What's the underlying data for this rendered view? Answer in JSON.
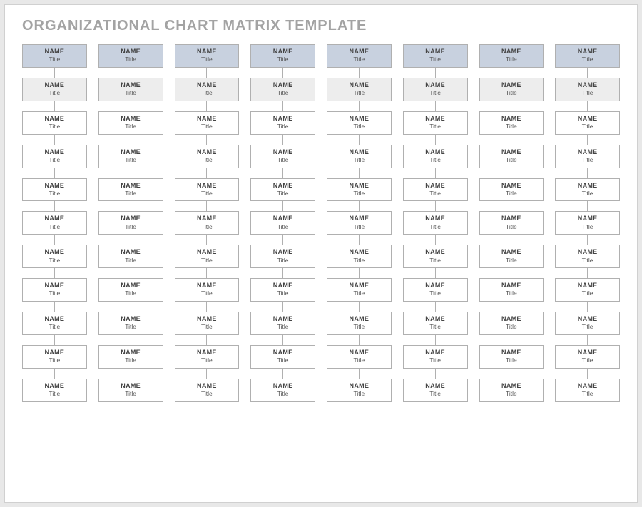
{
  "heading": "ORGANIZATIONAL CHART MATRIX TEMPLATE",
  "columns": [
    {
      "boxes": [
        {
          "name": "NAME",
          "title": "Title"
        },
        {
          "name": "NAME",
          "title": "Title"
        },
        {
          "name": "NAME",
          "title": "Title"
        },
        {
          "name": "NAME",
          "title": "Title"
        },
        {
          "name": "NAME",
          "title": "Title"
        },
        {
          "name": "NAME",
          "title": "Title"
        },
        {
          "name": "NAME",
          "title": "Title"
        },
        {
          "name": "NAME",
          "title": "Title"
        },
        {
          "name": "NAME",
          "title": "Title"
        },
        {
          "name": "NAME",
          "title": "Title"
        },
        {
          "name": "NAME",
          "title": "Title"
        }
      ]
    },
    {
      "boxes": [
        {
          "name": "NAME",
          "title": "Title"
        },
        {
          "name": "NAME",
          "title": "Title"
        },
        {
          "name": "NAME",
          "title": "Title"
        },
        {
          "name": "NAME",
          "title": "Title"
        },
        {
          "name": "NAME",
          "title": "Title"
        },
        {
          "name": "NAME",
          "title": "Title"
        },
        {
          "name": "NAME",
          "title": "Title"
        },
        {
          "name": "NAME",
          "title": "Title"
        },
        {
          "name": "NAME",
          "title": "Title"
        },
        {
          "name": "NAME",
          "title": "Title"
        },
        {
          "name": "NAME",
          "title": "Title"
        }
      ]
    },
    {
      "boxes": [
        {
          "name": "NAME",
          "title": "Title"
        },
        {
          "name": "NAME",
          "title": "Title"
        },
        {
          "name": "NAME",
          "title": "Title"
        },
        {
          "name": "NAME",
          "title": "Title"
        },
        {
          "name": "NAME",
          "title": "Title"
        },
        {
          "name": "NAME",
          "title": "Title"
        },
        {
          "name": "NAME",
          "title": "Title"
        },
        {
          "name": "NAME",
          "title": "Title"
        },
        {
          "name": "NAME",
          "title": "Title"
        },
        {
          "name": "NAME",
          "title": "Title"
        },
        {
          "name": "NAME",
          "title": "Title"
        }
      ]
    },
    {
      "boxes": [
        {
          "name": "NAME",
          "title": "Title"
        },
        {
          "name": "NAME",
          "title": "Title"
        },
        {
          "name": "NAME",
          "title": "Title"
        },
        {
          "name": "NAME",
          "title": "Title"
        },
        {
          "name": "NAME",
          "title": "Title"
        },
        {
          "name": "NAME",
          "title": "Title"
        },
        {
          "name": "NAME",
          "title": "Title"
        },
        {
          "name": "NAME",
          "title": "Title"
        },
        {
          "name": "NAME",
          "title": "Title"
        },
        {
          "name": "NAME",
          "title": "Title"
        },
        {
          "name": "NAME",
          "title": "Title"
        }
      ]
    },
    {
      "boxes": [
        {
          "name": "NAME",
          "title": "Title"
        },
        {
          "name": "NAME",
          "title": "Title"
        },
        {
          "name": "NAME",
          "title": "Title"
        },
        {
          "name": "NAME",
          "title": "Title"
        },
        {
          "name": "NAME",
          "title": "Title"
        },
        {
          "name": "NAME",
          "title": "Title"
        },
        {
          "name": "NAME",
          "title": "Title"
        },
        {
          "name": "NAME",
          "title": "Title"
        },
        {
          "name": "NAME",
          "title": "Title"
        },
        {
          "name": "NAME",
          "title": "Title"
        },
        {
          "name": "NAME",
          "title": "Title"
        }
      ]
    },
    {
      "boxes": [
        {
          "name": "NAME",
          "title": "Title"
        },
        {
          "name": "NAME",
          "title": "Title"
        },
        {
          "name": "NAME",
          "title": "Title"
        },
        {
          "name": "NAME",
          "title": "Title"
        },
        {
          "name": "NAME",
          "title": "Title"
        },
        {
          "name": "NAME",
          "title": "Title"
        },
        {
          "name": "NAME",
          "title": "Title"
        },
        {
          "name": "NAME",
          "title": "Title"
        },
        {
          "name": "NAME",
          "title": "Title"
        },
        {
          "name": "NAME",
          "title": "Title"
        },
        {
          "name": "NAME",
          "title": "Title"
        }
      ]
    },
    {
      "boxes": [
        {
          "name": "NAME",
          "title": "Title"
        },
        {
          "name": "NAME",
          "title": "Title"
        },
        {
          "name": "NAME",
          "title": "Title"
        },
        {
          "name": "NAME",
          "title": "Title"
        },
        {
          "name": "NAME",
          "title": "Title"
        },
        {
          "name": "NAME",
          "title": "Title"
        },
        {
          "name": "NAME",
          "title": "Title"
        },
        {
          "name": "NAME",
          "title": "Title"
        },
        {
          "name": "NAME",
          "title": "Title"
        },
        {
          "name": "NAME",
          "title": "Title"
        },
        {
          "name": "NAME",
          "title": "Title"
        }
      ]
    },
    {
      "boxes": [
        {
          "name": "NAME",
          "title": "Title"
        },
        {
          "name": "NAME",
          "title": "Title"
        },
        {
          "name": "NAME",
          "title": "Title"
        },
        {
          "name": "NAME",
          "title": "Title"
        },
        {
          "name": "NAME",
          "title": "Title"
        },
        {
          "name": "NAME",
          "title": "Title"
        },
        {
          "name": "NAME",
          "title": "Title"
        },
        {
          "name": "NAME",
          "title": "Title"
        },
        {
          "name": "NAME",
          "title": "Title"
        },
        {
          "name": "NAME",
          "title": "Title"
        },
        {
          "name": "NAME",
          "title": "Title"
        }
      ]
    }
  ]
}
